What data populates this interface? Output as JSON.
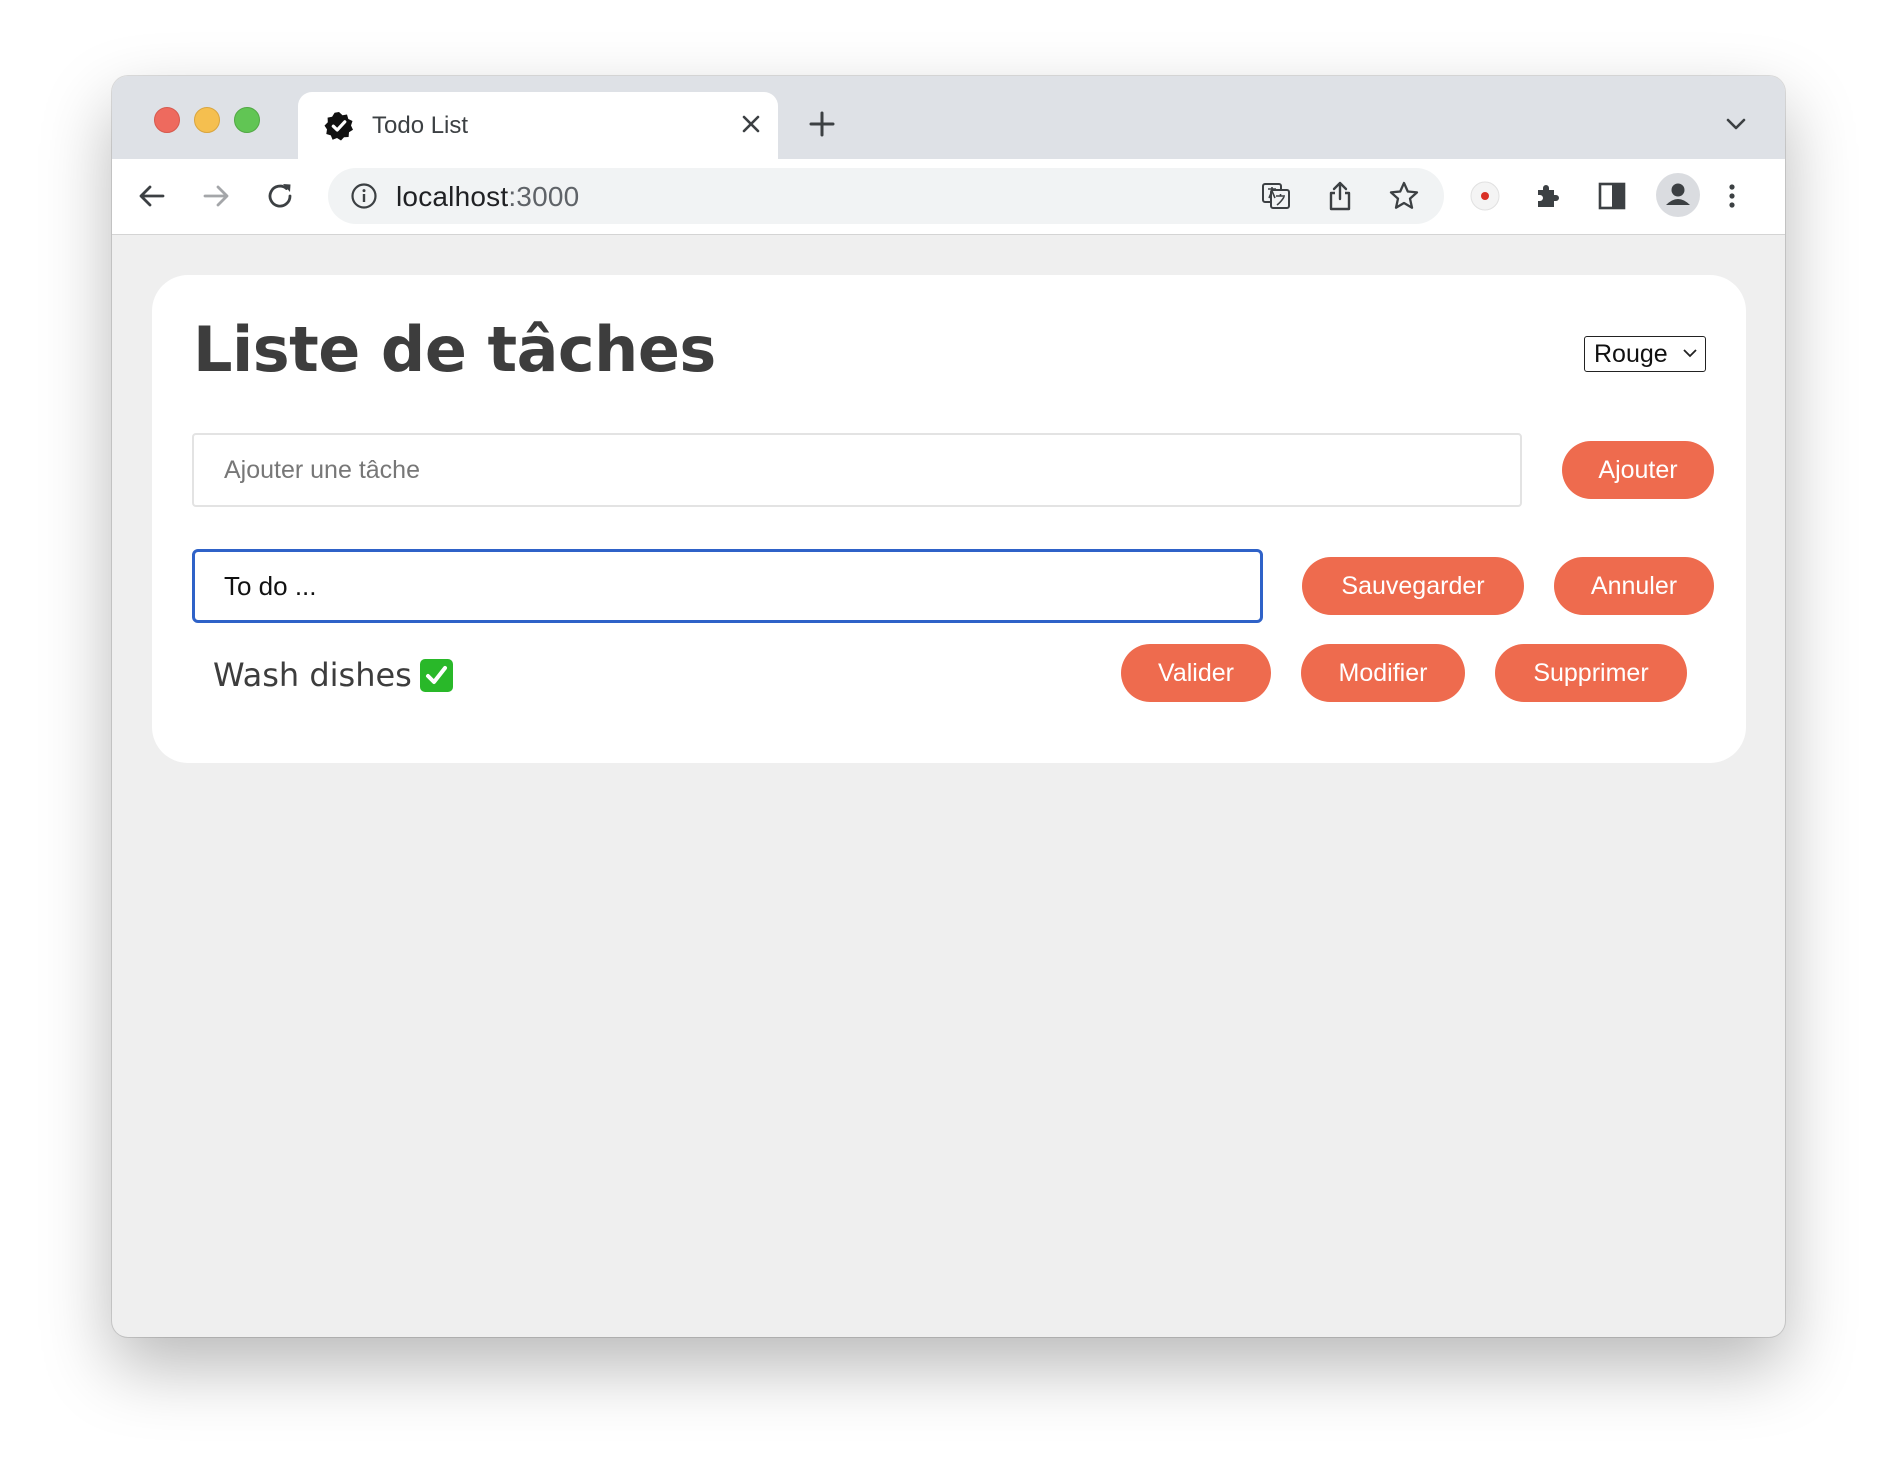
{
  "browser": {
    "tab_title": "Todo List",
    "url_host": "localhost",
    "url_port": ":3000"
  },
  "app": {
    "title": "Liste de tâches",
    "theme_select": {
      "selected": "Rouge"
    },
    "new_task": {
      "placeholder": "Ajouter une tâche",
      "value": "",
      "add_label": "Ajouter"
    },
    "edit_row": {
      "value": "To do ...",
      "save_label": "Sauvegarder",
      "cancel_label": "Annuler"
    },
    "todo_items": [
      {
        "text": "Wash dishes",
        "status_icon": "check-mark-button-icon",
        "validate_label": "Valider",
        "modify_label": "Modifier",
        "delete_label": "Supprimer"
      }
    ]
  },
  "colors": {
    "accent": "#ee6b4e",
    "focus_border": "#2f62c8",
    "page_background": "#efefef",
    "card_background": "#ffffff"
  }
}
